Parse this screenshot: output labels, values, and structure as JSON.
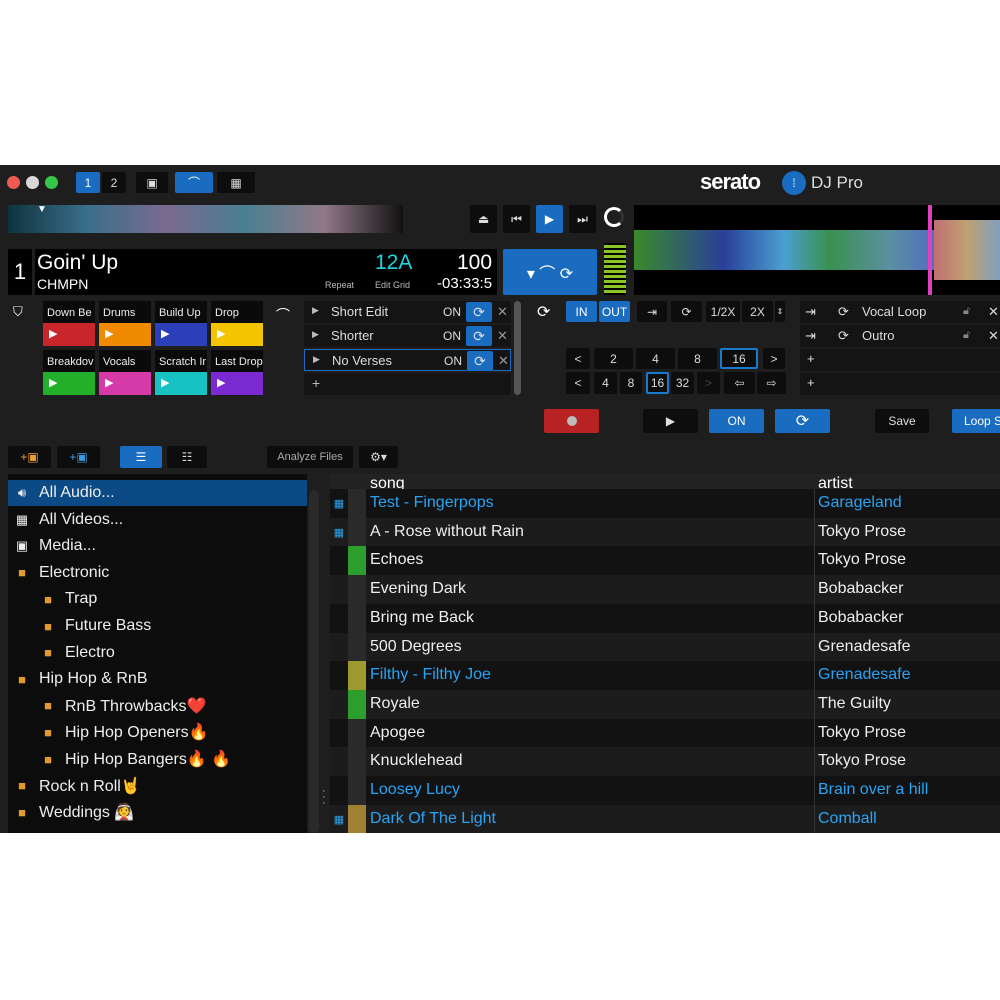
{
  "window": {
    "deck_tabs": [
      "1",
      "2"
    ]
  },
  "logo": {
    "brand": "serato",
    "product": "DJ Pro"
  },
  "deck": {
    "number": "1",
    "title": "Goin' Up",
    "artist": "CHMPN",
    "key": "12A",
    "bpm": "100",
    "time": "-03:33:5",
    "repeat_label": "Repeat",
    "edit_grid_label": "Edit Grid"
  },
  "cues": [
    {
      "label": "Down Be",
      "color": "#c8262a"
    },
    {
      "label": "Drums",
      "color": "#f08a00"
    },
    {
      "label": "Build Up",
      "color": "#2a3fb8"
    },
    {
      "label": "Drop",
      "color": "#f5c400"
    },
    {
      "label": "Breakdov",
      "color": "#22b02a"
    },
    {
      "label": "Vocals",
      "color": "#d63aa8"
    },
    {
      "label": "Scratch Ir",
      "color": "#18c2c2"
    },
    {
      "label": "Last Drop",
      "color": "#7a2ad0"
    }
  ],
  "flips": [
    {
      "name": "Short Edit",
      "state": "ON"
    },
    {
      "name": "Shorter",
      "state": "ON"
    },
    {
      "name": "No Verses",
      "state": "ON"
    }
  ],
  "loop_controls": {
    "in": "IN",
    "out": "OUT",
    "half": "1/2X",
    "double": "2X",
    "auto_loop": [
      "2",
      "4",
      "8",
      "16"
    ],
    "auto_loop_selected": "16",
    "beat_jump": [
      "4",
      "8",
      "16",
      "32"
    ],
    "beat_jump_selected": "16"
  },
  "saved_loops": [
    {
      "name": "Vocal Loop"
    },
    {
      "name": "Outro"
    }
  ],
  "bottom": {
    "on": "ON",
    "save": "Save",
    "loop_s": "Loop S"
  },
  "library": {
    "analyze": "Analyze Files"
  },
  "sidebar": [
    {
      "label": "All Audio...",
      "icon": "speaker",
      "indent": 0,
      "selected": true
    },
    {
      "label": "All Videos...",
      "icon": "film",
      "indent": 0
    },
    {
      "label": "Media...",
      "icon": "media",
      "indent": 0
    },
    {
      "label": "Electronic",
      "icon": "crate",
      "indent": 0
    },
    {
      "label": "Trap",
      "icon": "crate",
      "indent": 1
    },
    {
      "label": "Future Bass",
      "icon": "crate",
      "indent": 1
    },
    {
      "label": "Electro",
      "icon": "crate",
      "indent": 1
    },
    {
      "label": "Hip Hop & RnB",
      "icon": "crate",
      "indent": 0
    },
    {
      "label": "RnB Throwbacks❤️",
      "icon": "crate",
      "indent": 1
    },
    {
      "label": "Hip Hop Openers🔥",
      "icon": "crate",
      "indent": 1
    },
    {
      "label": "Hip Hop Bangers🔥 🔥",
      "icon": "crate",
      "indent": 1
    },
    {
      "label": "Rock n Roll🤘",
      "icon": "crate",
      "indent": 0
    },
    {
      "label": "Weddings 👰",
      "icon": "crate",
      "indent": 0
    }
  ],
  "tracklist": {
    "columns": [
      "song",
      "artist"
    ],
    "rows": [
      {
        "song": "Test - Fingerpops",
        "artist": "Garageland",
        "highlight": true,
        "video": true,
        "color": ""
      },
      {
        "song": "A - Rose without Rain",
        "artist": "Tokyo Prose",
        "video": true,
        "color": ""
      },
      {
        "song": "Echoes",
        "artist": "Tokyo Prose",
        "color": "#2d9e2d"
      },
      {
        "song": "Evening Dark",
        "artist": "Bobabacker",
        "color": ""
      },
      {
        "song": "Bring me Back",
        "artist": "Bobabacker",
        "color": ""
      },
      {
        "song": "500 Degrees",
        "artist": "Grenadesafe",
        "color": ""
      },
      {
        "song": "Filthy - Filthy Joe",
        "artist": "Grenadesafe",
        "highlight": true,
        "color": "#9c9a2e"
      },
      {
        "song": "Royale",
        "artist": "The Guilty",
        "color": "#2d9e2d"
      },
      {
        "song": "Apogee",
        "artist": "Tokyo Prose",
        "color": ""
      },
      {
        "song": "Knucklehead",
        "artist": "Tokyo Prose",
        "color": ""
      },
      {
        "song": "Loosey Lucy",
        "artist": "Brain over a hill",
        "highlight": true,
        "color": ""
      },
      {
        "song": "Dark Of The Light",
        "artist": "Comball",
        "highlight": true,
        "video": true,
        "color": "#a08032"
      }
    ]
  }
}
